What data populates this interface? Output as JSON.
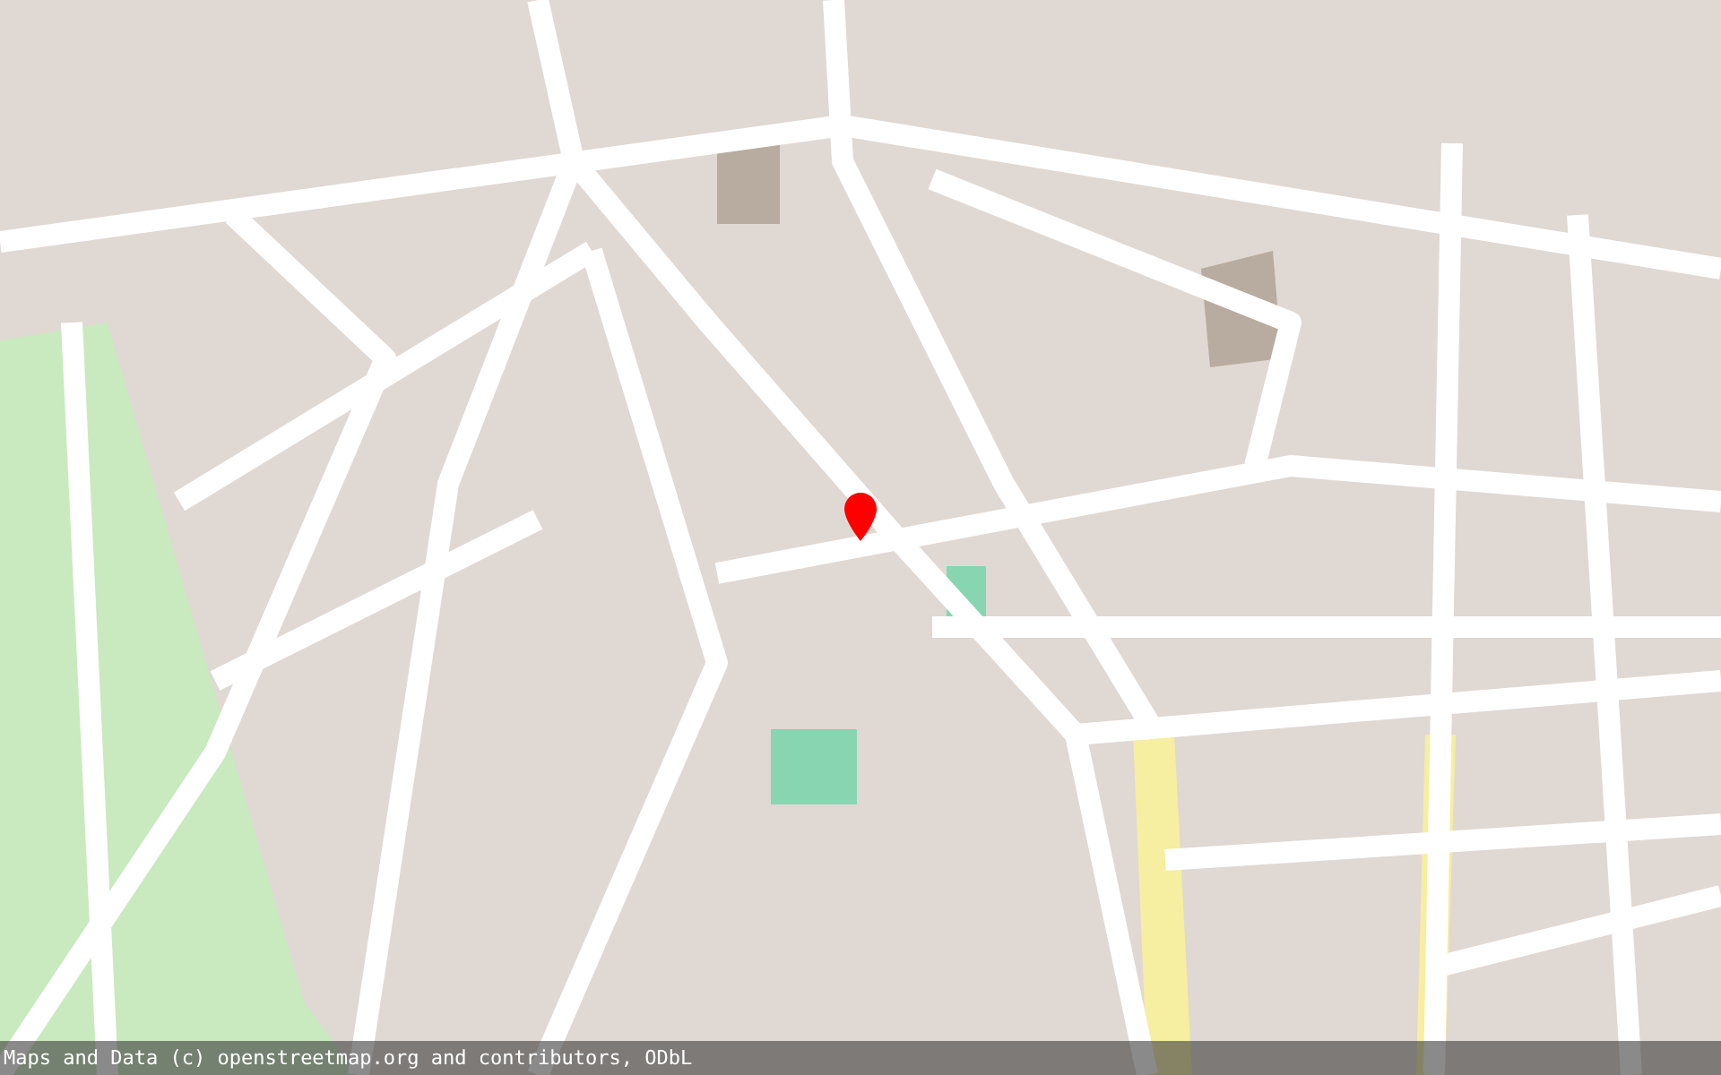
{
  "map": {
    "marker": {
      "visible": true
    }
  },
  "attribution": {
    "text": "Maps and Data (c) openstreetmap.org and contributors, ODbL"
  }
}
